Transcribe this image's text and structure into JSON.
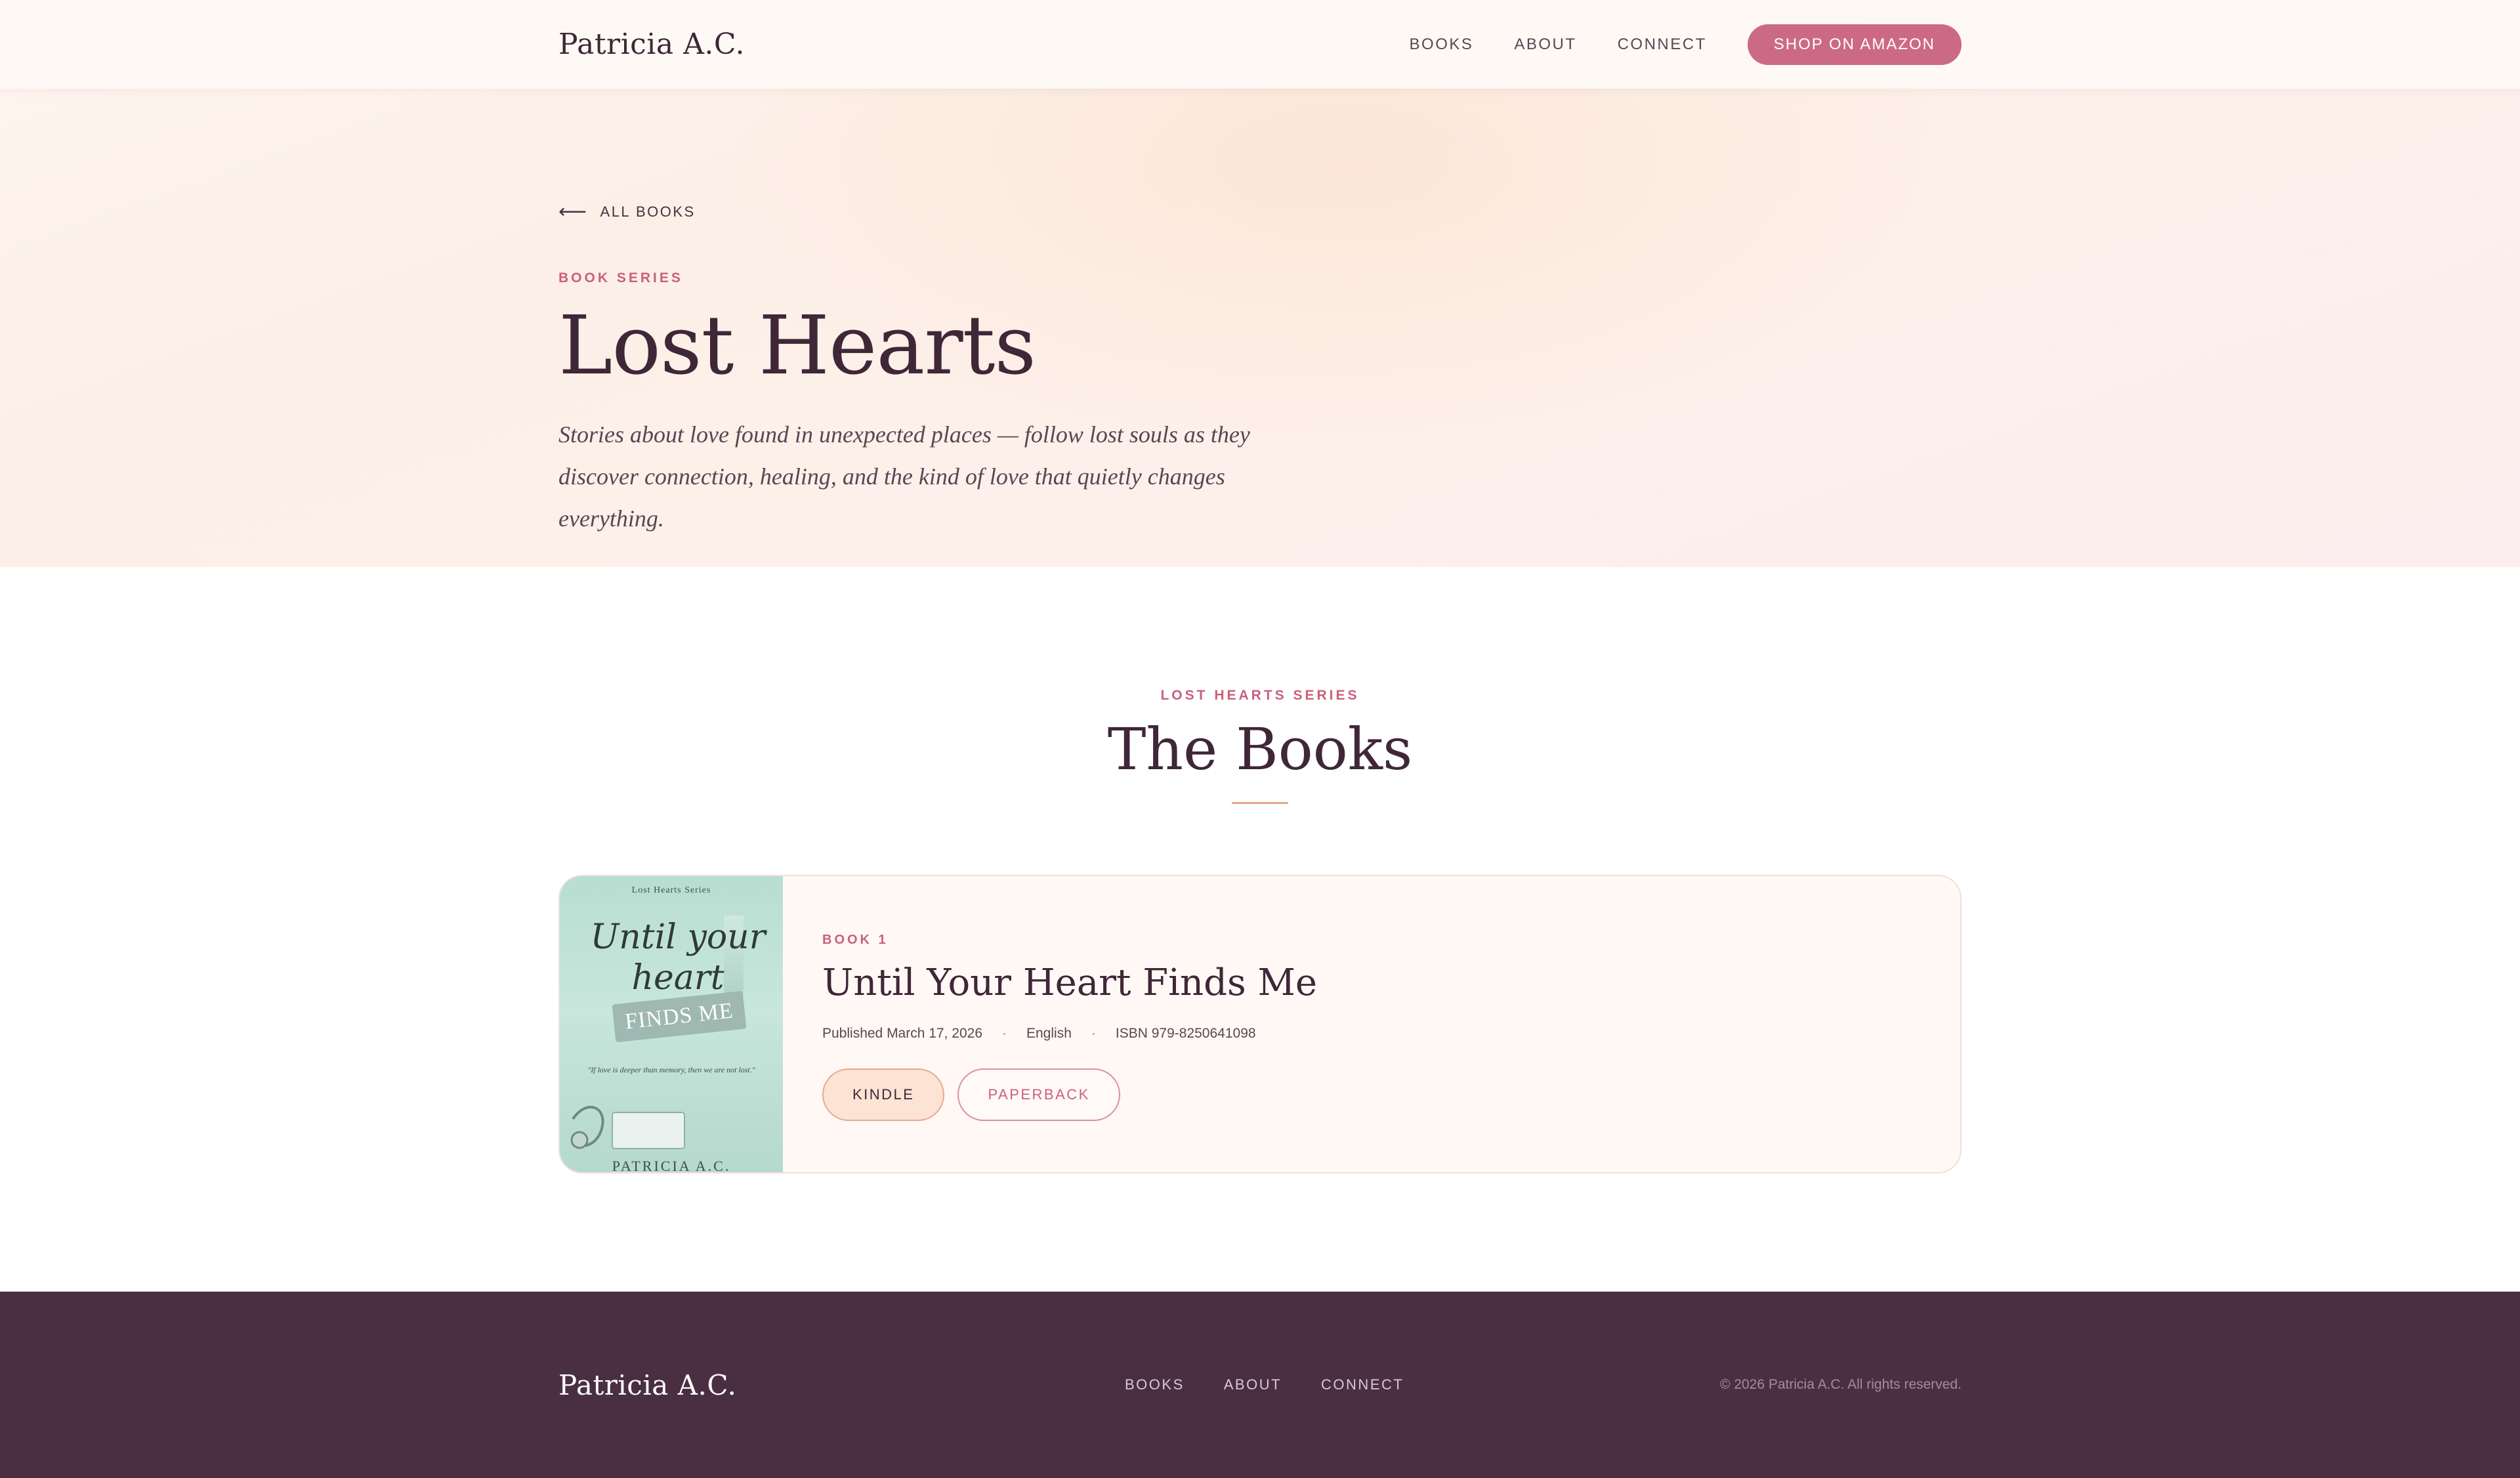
{
  "nav": {
    "logo": "Patricia A.C.",
    "links": [
      "BOOKS",
      "ABOUT",
      "CONNECT"
    ],
    "cta": "SHOP ON AMAZON"
  },
  "hero": {
    "back_label": "ALL BOOKS",
    "eyebrow": "BOOK SERIES",
    "title": "Lost Hearts",
    "description": "Stories about love found in unexpected places — follow lost souls as they discover connection, healing, and the kind of love that quietly changes everything."
  },
  "books_section": {
    "eyebrow": "LOST HEARTS SERIES",
    "title": "The Books"
  },
  "book": {
    "number": "BOOK 1",
    "title": "Until Your Heart Finds Me",
    "published": "Published March 17, 2026",
    "language": "English",
    "isbn": "ISBN 979-8250641098",
    "buttons": {
      "kindle": "KINDLE",
      "paperback": "PAPERBACK"
    },
    "cover": {
      "series": "Lost Hearts Series",
      "script": "Until your heart",
      "tag": "FINDS ME",
      "quote": "\"If love is deeper than memory, then we are not lost.\"",
      "author": "PATRICIA A.C."
    }
  },
  "footer": {
    "logo": "Patricia A.C.",
    "links": [
      "BOOKS",
      "ABOUT",
      "CONNECT"
    ],
    "copyright": "© 2026 Patricia A.C. All rights reserved."
  },
  "colors": {
    "accent": "#cd6a83",
    "plum": "#4a2e42",
    "hero_bg": "#fcefe7"
  }
}
